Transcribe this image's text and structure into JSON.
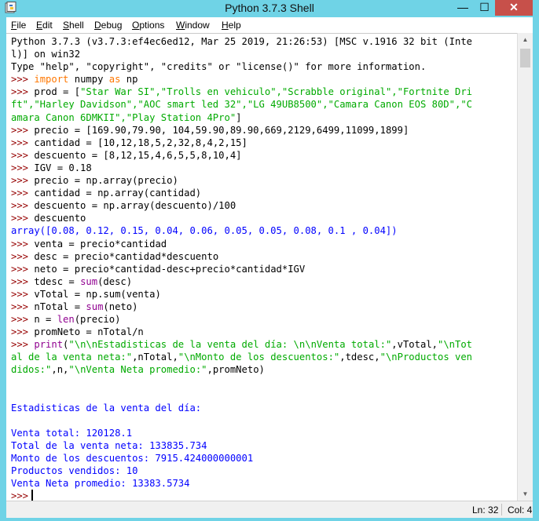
{
  "window": {
    "title": "Python 3.7.3 Shell",
    "min_label": "—",
    "max_label": "☐",
    "close_label": "✕"
  },
  "menu": [
    "File",
    "Edit",
    "Shell",
    "Debug",
    "Options",
    "Window",
    "Help"
  ],
  "shell": {
    "prompt": ">>>",
    "banner": [
      "Python 3.7.3 (v3.7.3:ef4ec6ed12, Mar 25 2019, 21:26:53) [MSC v.1916 32 bit (Inte",
      "l)] on win32",
      "Type \"help\", \"copyright\", \"credits\" or \"license()\" for more information."
    ],
    "code": {
      "import_kw": "import",
      "numpy": "numpy",
      "as_kw": "as",
      "np": "np",
      "prod_head": " prod = [",
      "prod_l1": "\"Star War SI\",\"Trolls en vehiculo\",\"Scrabble original\",\"Fortnite Dri",
      "prod_l2": "ft\",\"Harley Davidson\",\"AOC smart led 32\",\"LG 49UB8500\",\"Camara Canon EOS 80D\",\"C",
      "prod_l3": "amara Canon 6DMKII\",\"Play Station 4Pro\"",
      "prod_tail": "]",
      "precio": " precio = [169.90,79.90, 104,59.90,89.90,669,2129,6499,11099,1899]",
      "cantidad": " cantidad = [10,12,18,5,2,32,8,4,2,15]",
      "descuento": " descuento = [8,12,15,4,6,5,5,8,10,4]",
      "igv": " IGV = 0.18",
      "np_precio": " precio = np.array(precio)",
      "np_cantidad": " cantidad = np.array(cantidad)",
      "np_descuento": " descuento = np.array(descuento)/100",
      "show_descuento": " descuento",
      "array_out": "array([0.08, 0.12, 0.15, 0.04, 0.06, 0.05, 0.05, 0.08, 0.1 , 0.04])",
      "venta": " venta = precio*cantidad",
      "desc": " desc = precio*cantidad*descuento",
      "neto": " neto = precio*cantidad-desc+precio*cantidad*IGV",
      "tdesc_head": " tdesc = ",
      "sum": "sum",
      "tdesc_tail": "(desc)",
      "vtotal": " vTotal = np.sum(venta)",
      "ntotal_head": " nTotal = ",
      "ntotal_tail": "(neto)",
      "n_head": " n = ",
      "len": "len",
      "n_tail": "(precio)",
      "promneto": " promNeto = nTotal/n",
      "print_kw": "print",
      "print_l1_str1": "\"\\n\\nEstadisticas de la venta del día: \\n\\nVenta total:\"",
      "print_l1_mid": ",vTotal,",
      "print_l1_str2": "\"\\nTot",
      "print_l2_str1": "al de la venta neta:\"",
      "print_l2_mid": ",nTotal,",
      "print_l2_str2": "\"\\nMonto de los descuentos:\"",
      "print_l2_mid2": ",tdesc,",
      "print_l2_str3": "\"\\nProductos ven",
      "print_l3_str1": "didos:\"",
      "print_l3_mid": ",n,",
      "print_l3_str2": "\"\\nVenta Neta promedio:\"",
      "print_l3_tail": ",promNeto)"
    },
    "output": [
      "Estadisticas de la venta del día:",
      "Venta total: 120128.1",
      "Total de la venta neta: 133835.734",
      "Monto de los descuentos: 7915.424000000001",
      "Productos vendidos: 10",
      "Venta Neta promedio: 13383.5734"
    ]
  },
  "status": {
    "line": "Ln: 32",
    "col": "Col: 4"
  }
}
